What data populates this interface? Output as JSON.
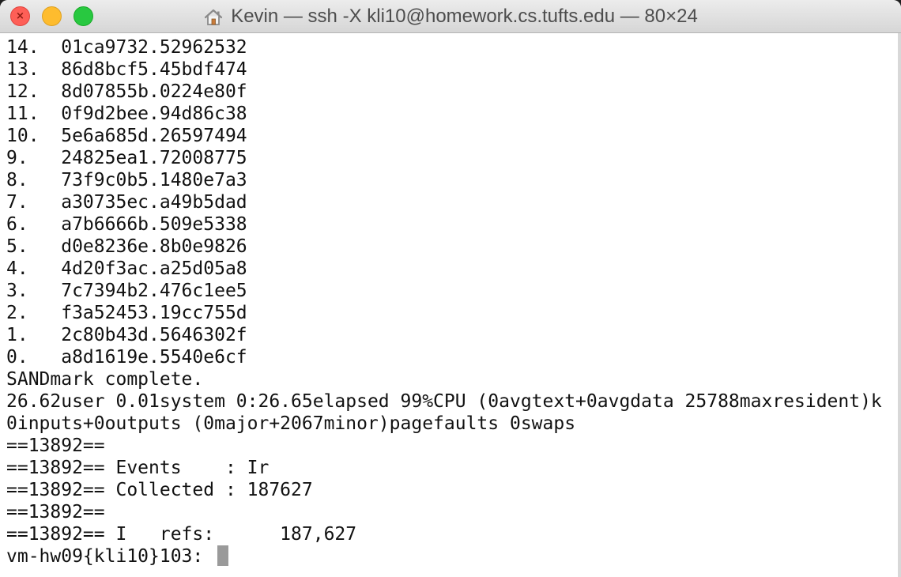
{
  "window": {
    "title": "Kevin — ssh -X kli10@homework.cs.tufts.edu — 80×24",
    "title_icon": "home-icon",
    "controls": {
      "close_color": "#fe5f57",
      "minimize_color": "#febc2e",
      "zoom_color": "#28c840"
    }
  },
  "terminal": {
    "lines": [
      "14.  01ca9732.52962532",
      "13.  86d8bcf5.45bdf474",
      "12.  8d07855b.0224e80f",
      "11.  0f9d2bee.94d86c38",
      "10.  5e6a685d.26597494",
      "9.   24825ea1.72008775",
      "8.   73f9c0b5.1480e7a3",
      "7.   a30735ec.a49b5dad",
      "6.   a7b6666b.509e5338",
      "5.   d0e8236e.8b0e9826",
      "4.   4d20f3ac.a25d05a8",
      "3.   7c7394b2.476c1ee5",
      "2.   f3a52453.19cc755d",
      "1.   2c80b43d.5646302f",
      "0.   a8d1619e.5540e6cf",
      "SANDmark complete.",
      "26.62user 0.01system 0:26.65elapsed 99%CPU (0avgtext+0avgdata 25788maxresident)k",
      "0inputs+0outputs (0major+2067minor)pagefaults 0swaps",
      "==13892==",
      "==13892== Events    : Ir",
      "==13892== Collected : 187627",
      "==13892==",
      "==13892== I   refs:      187,627"
    ],
    "prompt": "vm-hw09{kli10}103: "
  }
}
